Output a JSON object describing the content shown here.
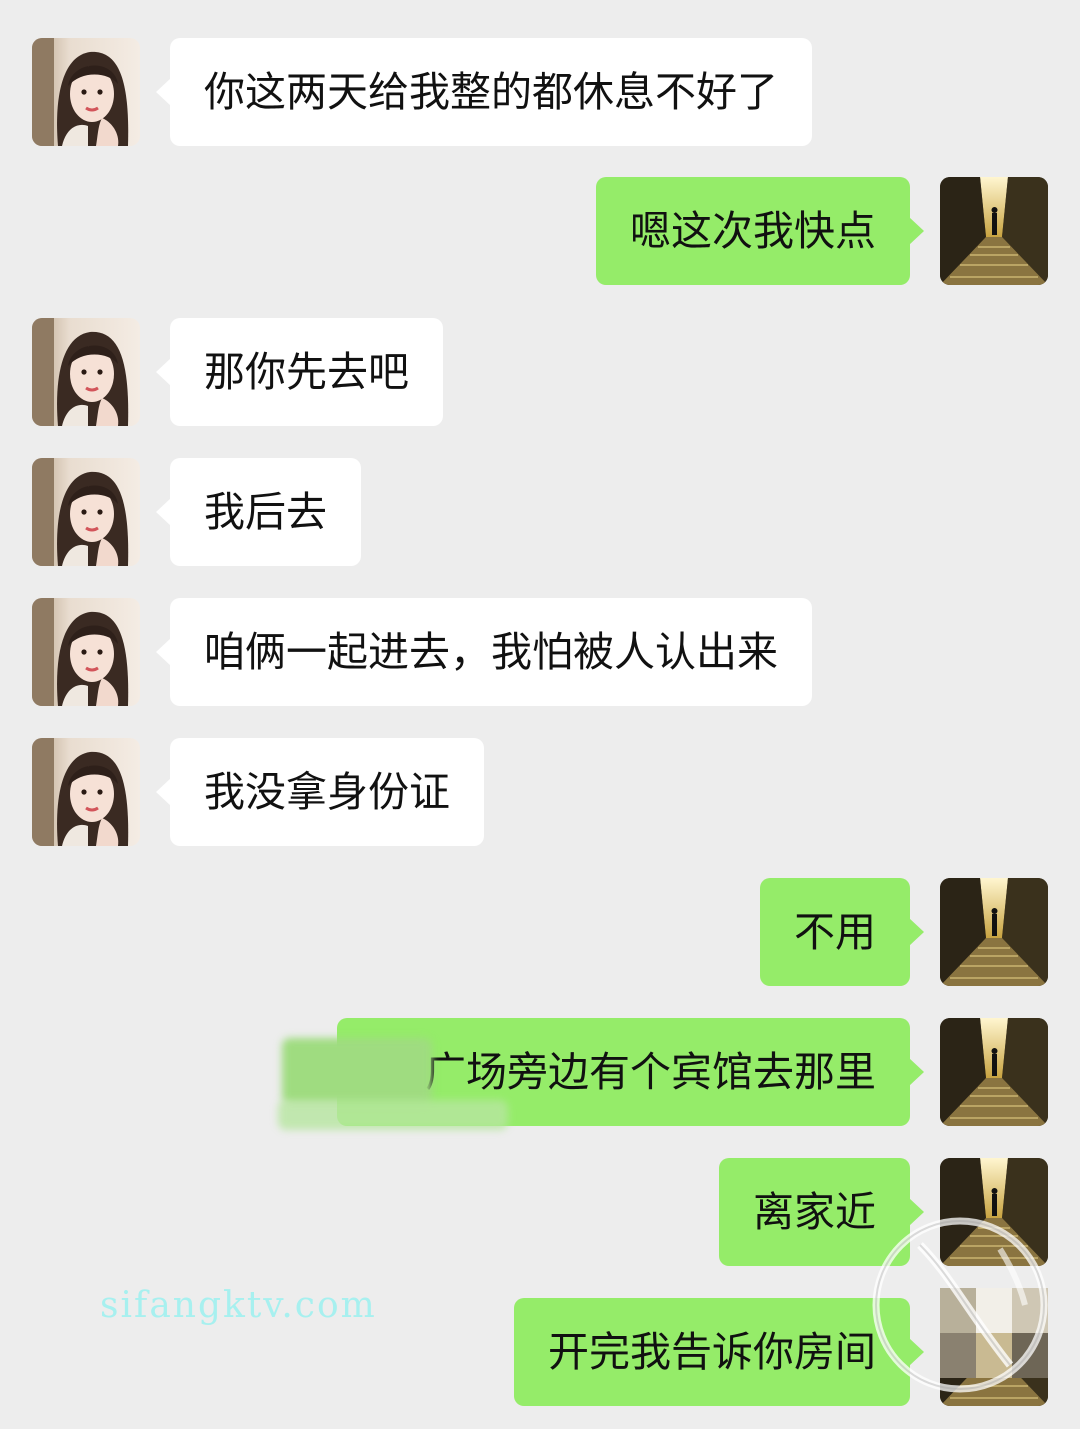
{
  "messages": [
    {
      "side": "left",
      "text": "你这两天给我整的都休息不好了"
    },
    {
      "side": "right",
      "text": "嗯这次我快点"
    },
    {
      "side": "left",
      "text": "那你先去吧"
    },
    {
      "side": "left",
      "text": "我后去"
    },
    {
      "side": "left",
      "text": "咱俩一起进去，我怕被人认出来"
    },
    {
      "side": "left",
      "text": "我没拿身份证"
    },
    {
      "side": "right",
      "text": "不用"
    },
    {
      "side": "right",
      "text": "恒   广场旁边有个宾馆去那里"
    },
    {
      "side": "right",
      "text": "离家近"
    },
    {
      "side": "right",
      "text": "开完我告诉你房间"
    }
  ],
  "avatars": {
    "left": "avatar-girl-photo",
    "right": "avatar-alley-photo"
  },
  "colors": {
    "background": "#ededed",
    "incoming_bubble": "#ffffff",
    "outgoing_bubble": "#95ec69",
    "watermark": "#a7f0ef"
  },
  "watermark": {
    "text": "sifangktv.com"
  }
}
